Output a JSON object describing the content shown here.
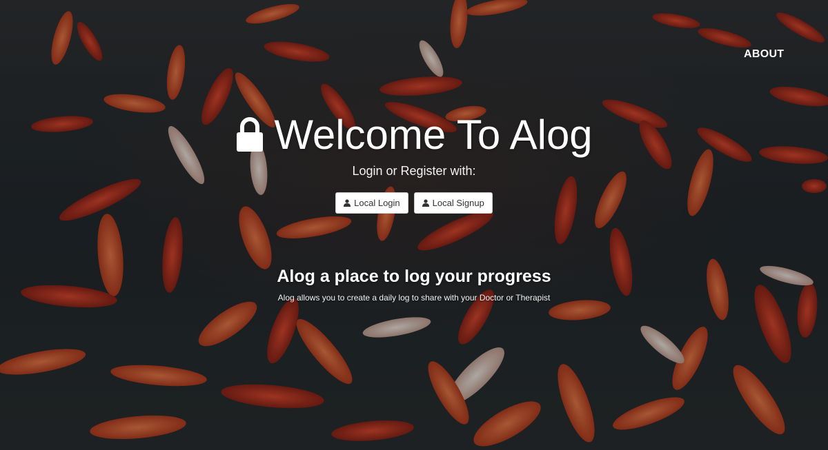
{
  "nav": {
    "about_label": "ABOUT"
  },
  "hero": {
    "title": "Welcome To Alog",
    "subtitle": "Login or Register with:",
    "title_icon": "lock-icon"
  },
  "auth": {
    "local_login_label": "Local Login",
    "local_signup_label": "Local Signup",
    "button_icon": "user-icon"
  },
  "tagline": {
    "heading": "Alog a place to log your progress",
    "description": "Alog allows you to create a daily log to share with your Doctor or Therapist"
  },
  "background": {
    "subject": "koi-pond-photo",
    "colors": {
      "water": "#1d2428",
      "koi_orange": "#e0532a",
      "koi_red": "#c8321e",
      "koi_white": "#f1e6df"
    }
  }
}
